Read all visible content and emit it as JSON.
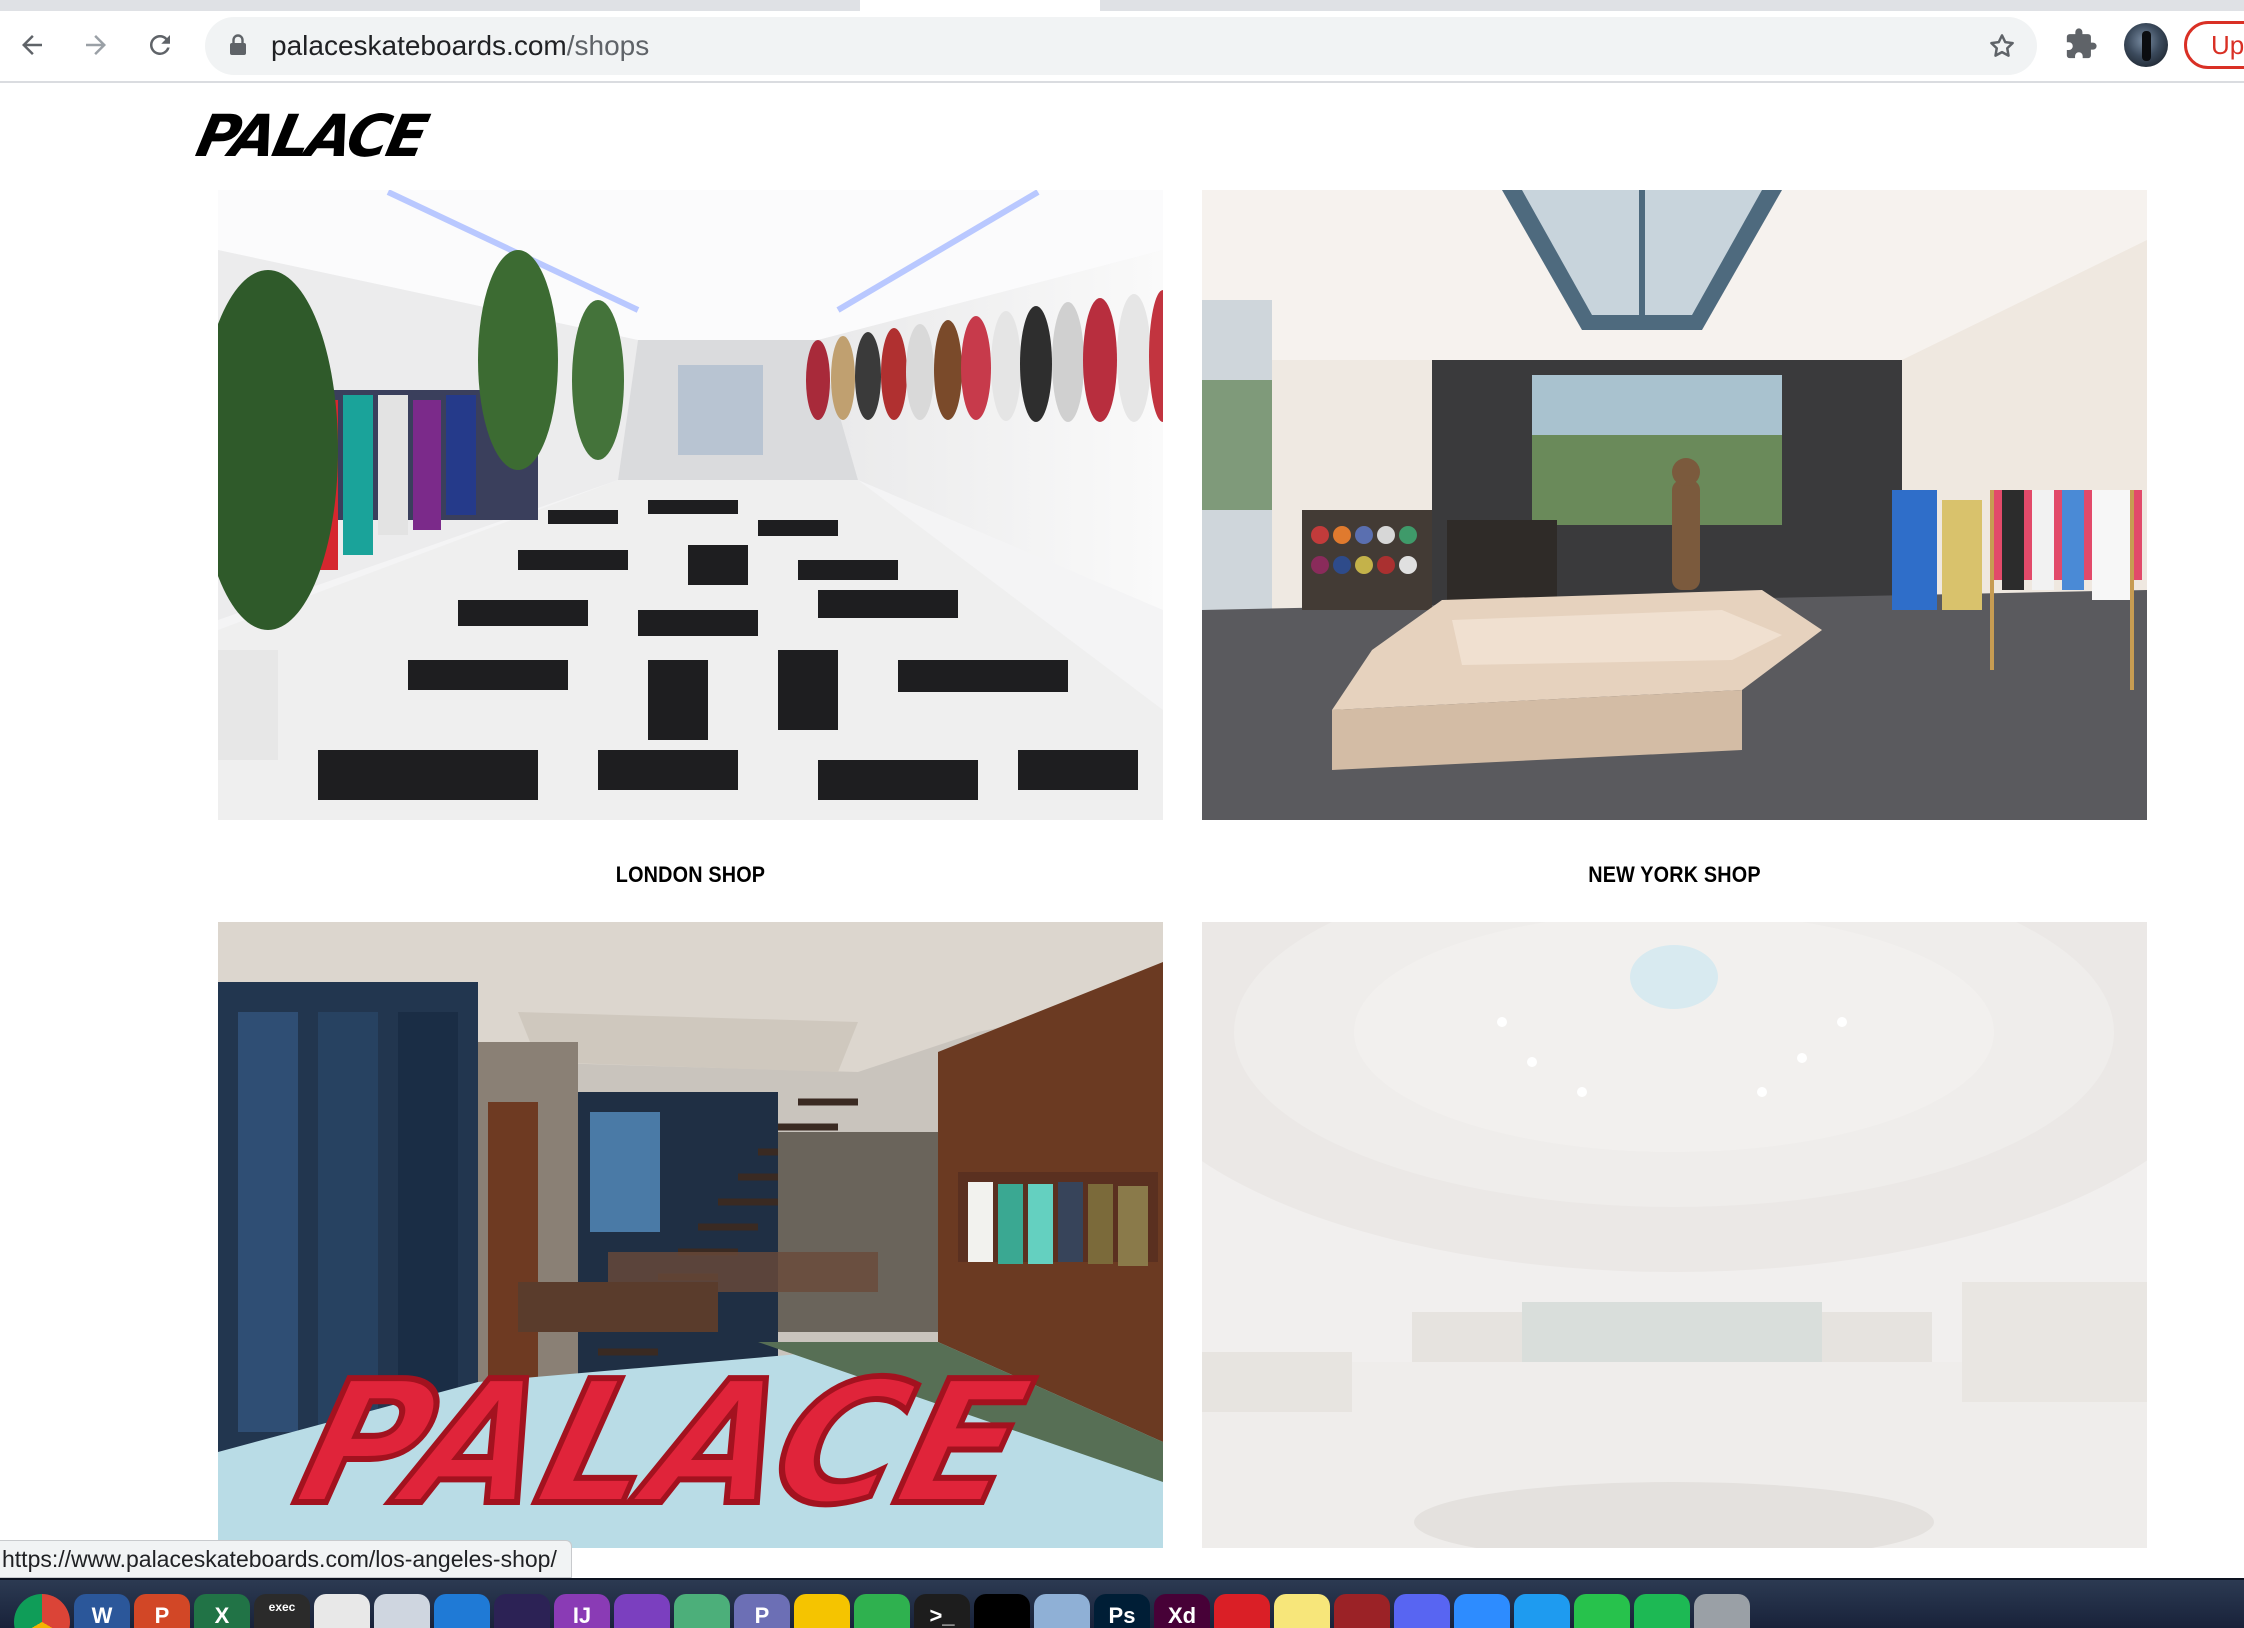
{
  "browser": {
    "url_domain": "palaceskateboards.com",
    "url_path": "/shops",
    "update_label": "Up",
    "status_url": "https://www.palaceskateboards.com/los-angeles-shop/"
  },
  "page": {
    "logo": "PALACE",
    "shops": [
      {
        "caption": "LONDON SHOP"
      },
      {
        "caption": "NEW YORK SHOP"
      },
      {
        "caption": ""
      },
      {
        "caption": ""
      }
    ],
    "la_sculpture_text": "PALACE"
  },
  "dock": {
    "items": [
      {
        "icon": "chrome-icon",
        "label": "",
        "color": "#ffffff"
      },
      {
        "icon": "word-icon",
        "label": "W",
        "color": "#2b579a"
      },
      {
        "icon": "powerpoint-icon",
        "label": "P",
        "color": "#d24726"
      },
      {
        "icon": "excel-icon",
        "label": "X",
        "color": "#217346"
      },
      {
        "icon": "terminal-exec-icon",
        "label": "exec",
        "color": "#2b2b2b"
      },
      {
        "icon": "python-icon",
        "label": "",
        "color": "#e8e8e8"
      },
      {
        "icon": "pen-icon",
        "label": "",
        "color": "#cfd6e0"
      },
      {
        "icon": "vscode-icon",
        "label": "",
        "color": "#1f7ad6"
      },
      {
        "icon": "eclipse-icon",
        "label": "",
        "color": "#2c2255"
      },
      {
        "icon": "intellij-icon",
        "label": "IJ",
        "color": "#8a3bb5"
      },
      {
        "icon": "github-icon",
        "label": "",
        "color": "#7b3fbf"
      },
      {
        "icon": "atom-icon",
        "label": "",
        "color": "#4caf7a"
      },
      {
        "icon": "protege-icon",
        "label": "P",
        "color": "#6c6fb5"
      },
      {
        "icon": "cyberduck-icon",
        "label": "",
        "color": "#f5c400"
      },
      {
        "icon": "sourcetree-icon",
        "label": "",
        "color": "#2fb14f"
      },
      {
        "icon": "terminal-icon",
        "label": ">_",
        "color": "#1d1d1d"
      },
      {
        "icon": "apple-terminal-icon",
        "label": "",
        "color": "#000000"
      },
      {
        "icon": "preview-icon",
        "label": "",
        "color": "#8fb0d6"
      },
      {
        "icon": "photoshop-icon",
        "label": "Ps",
        "color": "#001e36"
      },
      {
        "icon": "xd-icon",
        "label": "Xd",
        "color": "#470137"
      },
      {
        "icon": "creative-cloud-icon",
        "label": "",
        "color": "#da1f26"
      },
      {
        "icon": "stickies-icon",
        "label": "",
        "color": "#f7e67a"
      },
      {
        "icon": "dictionary-icon",
        "label": "",
        "color": "#9b2226"
      },
      {
        "icon": "discord-icon",
        "label": "",
        "color": "#5865f2"
      },
      {
        "icon": "zoom-icon",
        "label": "",
        "color": "#2d8cff"
      },
      {
        "icon": "messages-icon",
        "label": "",
        "color": "#1e9bf0"
      },
      {
        "icon": "facetime-icon",
        "label": "",
        "color": "#27c24c"
      },
      {
        "icon": "spotify-icon",
        "label": "",
        "color": "#1db954"
      },
      {
        "icon": "launchpad-icon",
        "label": "",
        "color": "#9aa0a6"
      }
    ]
  }
}
